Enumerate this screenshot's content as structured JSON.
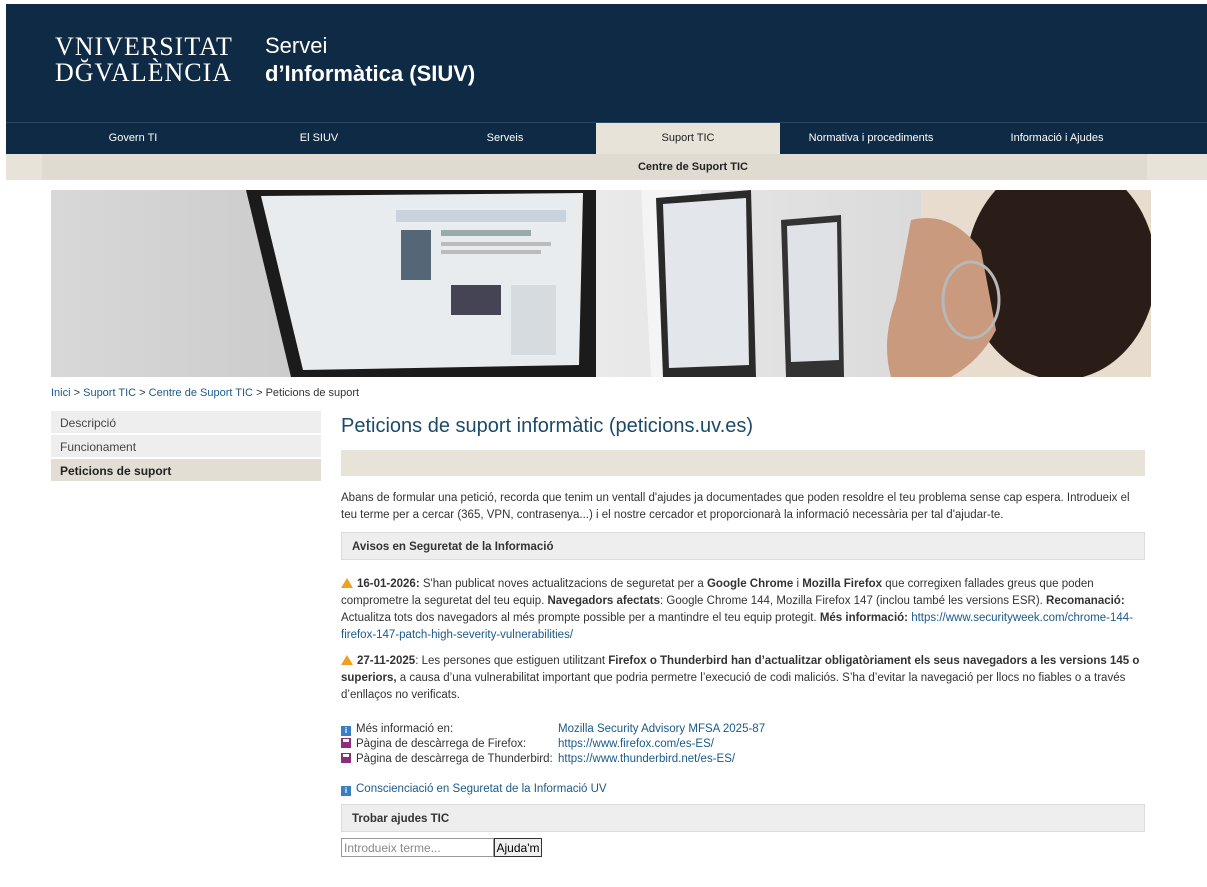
{
  "header": {
    "logo_line1": "VNIVERSITAT",
    "logo_line2": "DĞVALÈNCIA",
    "service_line1": "Servei",
    "service_line2": "d’Informàtica (SIUV)"
  },
  "nav": {
    "items": [
      {
        "label": "Govern TI"
      },
      {
        "label": "El SIUV"
      },
      {
        "label": "Serveis"
      },
      {
        "label": "Suport TIC"
      },
      {
        "label": "Normativa i procediments"
      },
      {
        "label": "Informació i Ajudes"
      }
    ],
    "active": "Suport TIC"
  },
  "subnav": {
    "label": "Centre de Suport TIC"
  },
  "breadcrumb": {
    "items": [
      "Inici",
      "Suport TIC",
      "Centre de Suport TIC"
    ],
    "separator": " > ",
    "current": "Peticions de suport"
  },
  "sidebar": {
    "items": [
      {
        "label": "Descripció"
      },
      {
        "label": "Funcionament"
      },
      {
        "label": "Peticions de suport"
      }
    ],
    "active": "Peticions de suport"
  },
  "main": {
    "title": "Peticions de suport informàtic (peticions.uv.es)",
    "intro": "Abans de formular una petició, recorda que tenim un ventall d'ajudes ja documentades que poden resoldre el teu problema sense cap espera. Introdueix el teu terme per a cercar (365, VPN, contrasenya...) i el nostre cercador et proporcionarà la informació necessària per tal d'ajudar-te.",
    "avisos_heading": "Avisos en Seguretat de la Informació",
    "notice1": {
      "date": "16-01-2026:",
      "t1": " S'han publicat noves actualitzacions de seguretat per a ",
      "b1": "Google Chrome",
      "t2": " i ",
      "b2": "Mozilla Firefox",
      "t3": " que corregixen fallades greus que poden comprometre la seguretat del teu equip. ",
      "b3": "Navegadors afectats",
      "t4": ": Google Chrome 144, Mozilla Firefox 147 (inclou també les versions ESR). ",
      "b4": "Recomanació:",
      "t5": " Actualitza tots dos navegadors al més prompte possible per a mantindre el teu equip protegit. ",
      "b5": "Més informació:",
      "link": "https://www.securityweek.com/chrome-144-firefox-147-patch-high-severity-vulnerabilities/"
    },
    "notice2": {
      "date": "27-11-2025",
      "t1": ": Les persones que estiguen utilitzant ",
      "b1": "Firefox o Thunderbird han d’actualitzar obligatòriament els seus navegadors a les versions 145 o superiors,",
      "t2": " a causa d’una vulnerabilitat important que podria permetre l’execució de codi maliciós. S’ha d’evitar la navegació per llocs no fiables o a través d’enllaços no verificats."
    },
    "links": [
      {
        "icon": "info-icon",
        "label": "Més informació en:",
        "value": "Mozilla Security Advisory MFSA 2025-87"
      },
      {
        "icon": "save-icon",
        "label": "Pàgina de descàrrega de Firefox:",
        "value": "https://www.firefox.com/es-ES/"
      },
      {
        "icon": "save-icon",
        "label": "Pàgina de descàrrega de Thunderbird:",
        "value": "https://www.thunderbird.net/es-ES/"
      }
    ],
    "awareness_link": "Conscienciació en Seguretat de la Informació UV",
    "trobar_heading": "Trobar ajudes TIC",
    "search": {
      "placeholder": "Introdueix terme...",
      "button": "Ajuda'm"
    }
  }
}
